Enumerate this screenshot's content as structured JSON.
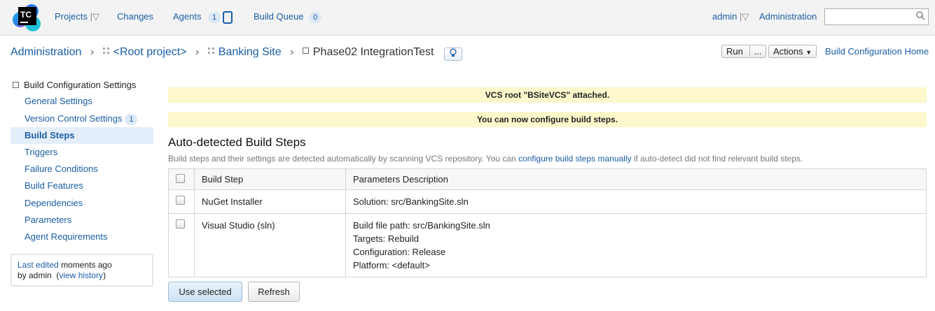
{
  "logo": {
    "text": "TC"
  },
  "topnav": {
    "projects": "Projects",
    "changes": "Changes",
    "agents": "Agents",
    "agents_count": "1",
    "build_queue": "Build Queue",
    "build_queue_count": "0",
    "user": "admin",
    "administration": "Administration",
    "search_value": ""
  },
  "breadcrumb": {
    "items": [
      "Administration",
      "<Root project>",
      "Banking Site"
    ],
    "current": "Phase02 IntegrationTest"
  },
  "toolbar": {
    "run": "Run",
    "run_more": "...",
    "actions": "Actions",
    "config_home": "Build Configuration Home"
  },
  "sidebar": {
    "title": "Build Configuration Settings",
    "items": [
      {
        "label": "General Settings"
      },
      {
        "label": "Version Control Settings",
        "badge": "1"
      },
      {
        "label": "Build Steps"
      },
      {
        "label": "Triggers"
      },
      {
        "label": "Failure Conditions"
      },
      {
        "label": "Build Features"
      },
      {
        "label": "Dependencies"
      },
      {
        "label": "Parameters"
      },
      {
        "label": "Agent Requirements"
      }
    ],
    "active_index": 2,
    "last_edited_link": "Last edited",
    "last_edited_text": "moments ago",
    "by_text": "by admin",
    "view_history": "view history"
  },
  "notices": [
    "VCS root \"BSiteVCS\" attached.",
    "You can now configure build steps."
  ],
  "main": {
    "heading": "Auto-detected Build Steps",
    "desc_before": "Build steps and their settings are detected automatically by scanning VCS repository. You can ",
    "desc_link": "configure build steps manually",
    "desc_after": " if auto-detect did not find relevant build steps.",
    "columns": [
      "Build Step",
      "Parameters Description"
    ],
    "rows": [
      {
        "step": "NuGet Installer",
        "params": [
          "Solution: src/BankingSite.sln"
        ]
      },
      {
        "step": "Visual Studio (sln)",
        "params": [
          "Build file path: src/BankingSite.sln",
          "Targets: Rebuild",
          "Configuration: Release",
          "Platform: <default>"
        ]
      }
    ],
    "use_selected": "Use selected",
    "refresh": "Refresh"
  },
  "colors": {
    "link": "#1a5ea5",
    "notice_bg": "#fcf8cc",
    "active_bg": "#e4eefa"
  }
}
